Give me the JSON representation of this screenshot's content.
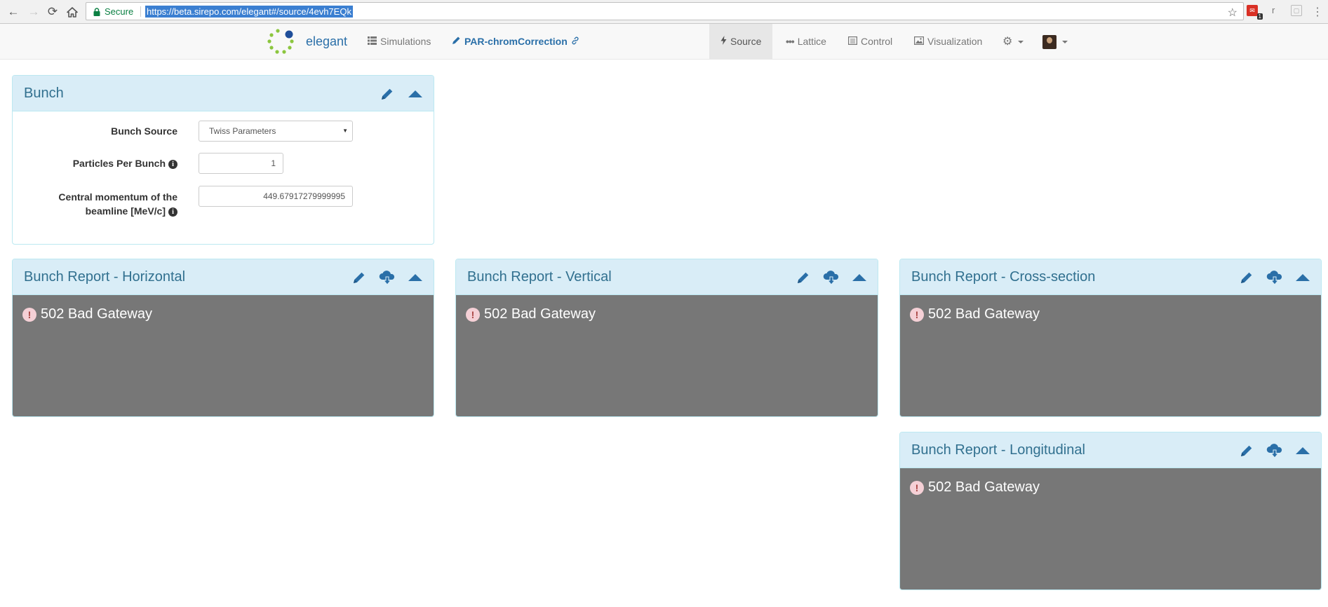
{
  "browser": {
    "secure_label": "Secure",
    "url": "https://beta.sirepo.com/elegant#/source/4evh7EQk",
    "extensions": {
      "ext1_count": "1",
      "ext2_label": "r"
    }
  },
  "app": {
    "brand": "elegant",
    "simulations_label": "Simulations",
    "simulation_name": "PAR-chromCorrection",
    "tabs": [
      {
        "label": "Source",
        "icon": "bolt-icon",
        "active": true
      },
      {
        "label": "Lattice",
        "icon": "ellipsis-icon",
        "active": false
      },
      {
        "label": "Control",
        "icon": "list-alt-icon",
        "active": false
      },
      {
        "label": "Visualization",
        "icon": "picture-icon",
        "active": false
      }
    ]
  },
  "bunch": {
    "title": "Bunch",
    "fields": [
      {
        "label": "Bunch Source",
        "value": "Twiss Parameters",
        "type": "select"
      },
      {
        "label": "Particles Per Bunch",
        "value": "1",
        "type": "number",
        "info": true
      },
      {
        "label": "Central momentum of the beamline [MeV/c]",
        "value": "449.67917279999995",
        "type": "number",
        "info": true
      }
    ]
  },
  "reports": [
    {
      "title": "Bunch Report - Horizontal",
      "error": "502 Bad Gateway"
    },
    {
      "title": "Bunch Report - Vertical",
      "error": "502 Bad Gateway"
    },
    {
      "title": "Bunch Report - Cross-section",
      "error": "502 Bad Gateway"
    },
    {
      "title": "Bunch Report - Longitudinal",
      "error": "502 Bad Gateway"
    }
  ],
  "colors": {
    "panel_heading_bg": "#d9edf7",
    "panel_title": "#31708f",
    "icon_blue": "#2a6fa8",
    "error_body_bg": "#777777"
  }
}
